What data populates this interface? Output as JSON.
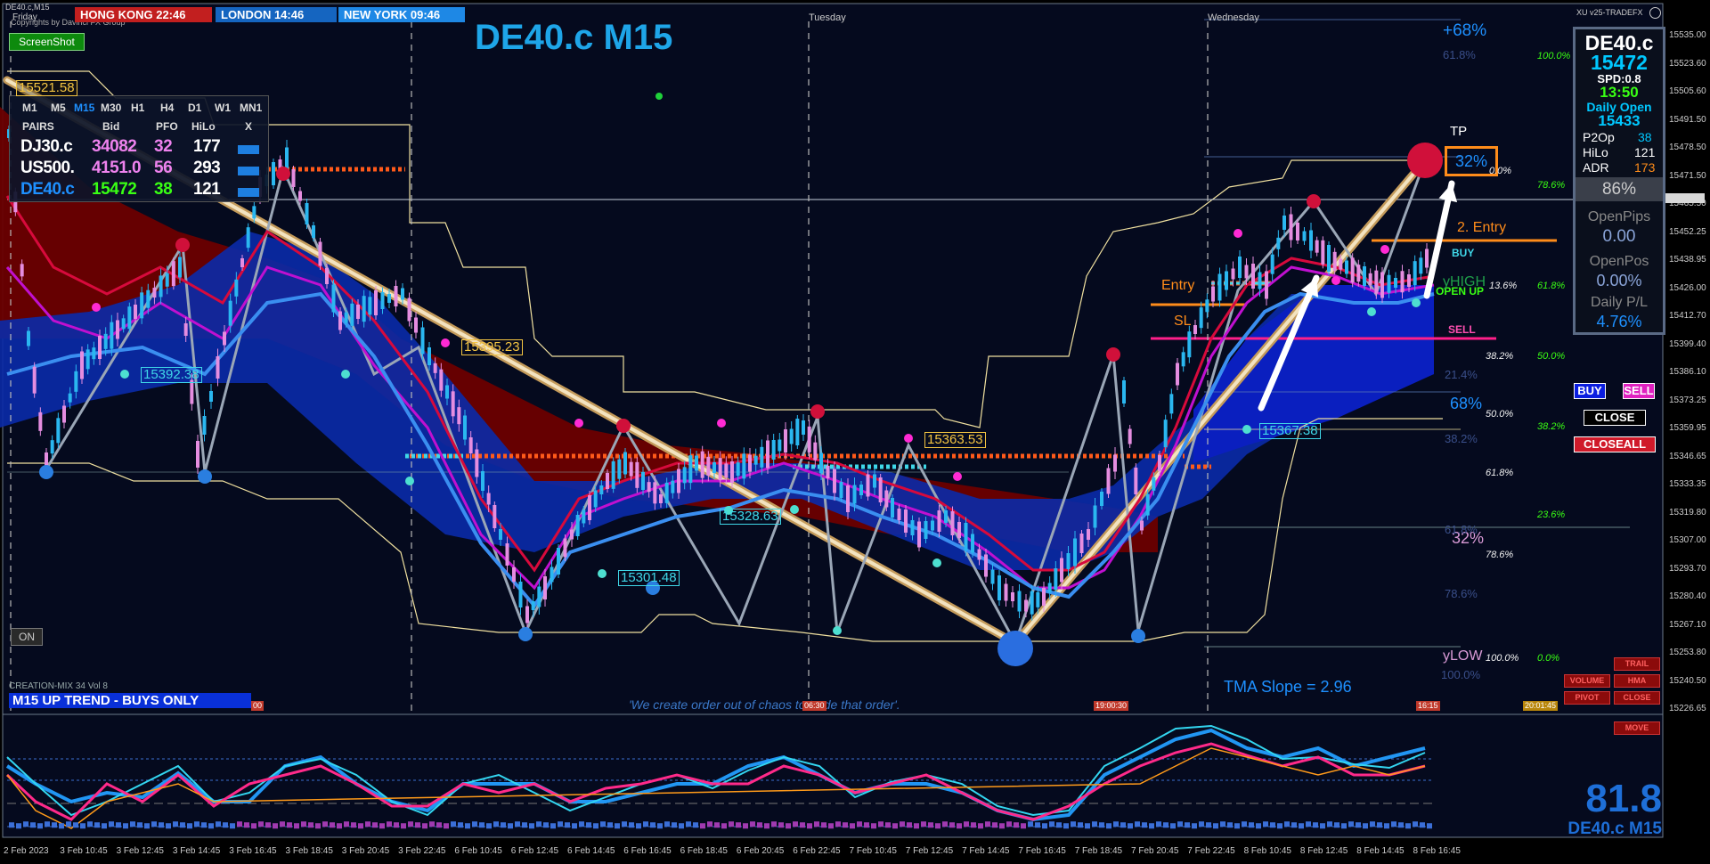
{
  "window": {
    "title": "DE40.c,M15",
    "copyright": "Copyrights by Davinci FX Group",
    "version": "XU v25-TRADEFX"
  },
  "clocks": [
    {
      "label": "HONG KONG 22:46",
      "color": "#c21f1f"
    },
    {
      "label": "LONDON  14:46",
      "color": "#1565c0"
    },
    {
      "label": "NEW YORK  09:46",
      "color": "#1e88e5"
    }
  ],
  "screenshot_button": "ScreenShot",
  "chart_title": "DE40.c M15",
  "days": [
    "Friday",
    "Tuesday",
    "Wednesday"
  ],
  "pairs_panel": {
    "timeframes": [
      "M1",
      "M5",
      "M15",
      "M30",
      "H1",
      "H4",
      "D1",
      "W1",
      "MN1"
    ],
    "active_timeframe": "M15",
    "headers": [
      "PAIRS",
      "Bid",
      "PFO",
      "HiLo",
      "X"
    ],
    "rows": [
      {
        "pair": "DJ30.c",
        "bid": "34082",
        "pfo": "32",
        "hilo": "177",
        "pair_color": "#ffffff",
        "bid_color": "#ee82ee",
        "pfo_color": "#ee82ee"
      },
      {
        "pair": "US500.",
        "bid": "4151.0",
        "pfo": "56",
        "hilo": "293",
        "pair_color": "#ffffff",
        "bid_color": "#ee82ee",
        "pfo_color": "#ee82ee"
      },
      {
        "pair": "DE40.c",
        "bid": "15472",
        "pfo": "38",
        "hilo": "121",
        "pair_color": "#1e90ff",
        "bid_color": "#39ff14",
        "pfo_color": "#39ff14"
      }
    ]
  },
  "price_labels": [
    "15521.58",
    "15392.38",
    "15395.23",
    "15363.53",
    "15328.63",
    "15301.48",
    "15367.38"
  ],
  "trade_labels": {
    "entry": "Entry",
    "sl": "SL",
    "entry2": "2. Entry",
    "buy": "BUY",
    "sell": "SELL",
    "open_up": "OPEN UP",
    "tp": "TP",
    "yhigh": "yHIGH",
    "ylow": "yLOW"
  },
  "percent_labels": {
    "top": "+68%",
    "tp_box": "32%",
    "right_pct": "86%",
    "mid_68": "68%",
    "low_32": "32%"
  },
  "fib_blue": [
    "61.8%",
    "21.4%",
    "38.2%",
    "61.8%",
    "78.6%",
    "100.0%"
  ],
  "fib_italic": [
    "100.0%",
    "78.6%",
    "61.8%",
    "50.0%",
    "38.2%",
    "23.6%",
    "0.0%",
    "0.0%",
    "13.6%",
    "38.2%",
    "50.0%",
    "61.8%",
    "78.6%",
    "100.0%"
  ],
  "tma_slope": "TMA Slope = 2.96",
  "slogan": "'We create order out of chaos to trade that order'.",
  "on_button": "ON",
  "creation_label": "CREATION-MIX 34 Vol 8",
  "trend_banner": "M15 UP TREND - BUYS ONLY",
  "info_panel": {
    "symbol": "DE40.c",
    "price": "15472",
    "spread": "SPD:0.8",
    "time": "13:50",
    "daily_open_label": "Daily Open",
    "daily_open": "15433",
    "p2op_label": "P2Op",
    "p2op": "38",
    "hilo_label": "HiLo",
    "hilo": "121",
    "adr_label": "ADR",
    "adr": "173",
    "percent": "86%",
    "openpips_label": "OpenPips",
    "openpips": "0.00",
    "openpos_label": "OpenPos",
    "openpos": "0.00%",
    "dailypl_label": "Daily P/L",
    "dailypl": "4.76%"
  },
  "trade_buttons": {
    "buy": "BUY",
    "sell": "SELL",
    "close": "CLOSE",
    "closeall": "CLOSEALL"
  },
  "status_tags": [
    "TRAIL",
    "VOLUME",
    "PIVOT",
    "HMA",
    "CLOSE",
    "MOVE"
  ],
  "price_axis": [
    "15535.00",
    "15523.60",
    "15505.60",
    "15491.50",
    "15478.50",
    "15471.50",
    "15465.50",
    "15452.25",
    "15438.95",
    "15426.00",
    "15412.70",
    "15399.40",
    "15386.10",
    "15373.25",
    "15359.95",
    "15346.65",
    "15333.35",
    "15319.80",
    "15307.00",
    "15293.70",
    "15280.40",
    "15267.10",
    "15253.80",
    "15240.50",
    "15226.65"
  ],
  "indicator": {
    "value": "81.8",
    "label": "DE40.c M15"
  },
  "date_axis": [
    "2 Feb 2023",
    "3 Feb 10:45",
    "3 Feb 12:45",
    "3 Feb 14:45",
    "3 Feb 16:45",
    "3 Feb 18:45",
    "3 Feb 20:45",
    "3 Feb 22:45",
    "6 Feb 10:45",
    "6 Feb 12:45",
    "6 Feb 14:45",
    "6 Feb 16:45",
    "6 Feb 18:45",
    "6 Feb 20:45",
    "6 Feb 22:45",
    "7 Feb 10:45",
    "7 Feb 12:45",
    "7 Feb 14:45",
    "7 Feb 16:45",
    "7 Feb 18:45",
    "7 Feb 20:45",
    "7 Feb 22:45",
    "8 Feb 10:45",
    "8 Feb 12:45",
    "8 Feb 14:45",
    "8 Feb 16:45"
  ],
  "time_tags": [
    "00",
    "06:30",
    "19:00:30",
    "16:15",
    "20:01:45"
  ],
  "colors": {
    "background": "#050a1e",
    "bull": "#2ab7f0",
    "bear": "#e58de0",
    "red_band": "#8b0000",
    "blue_band": "#0a2aa8",
    "accent": "#1e90ff"
  }
}
